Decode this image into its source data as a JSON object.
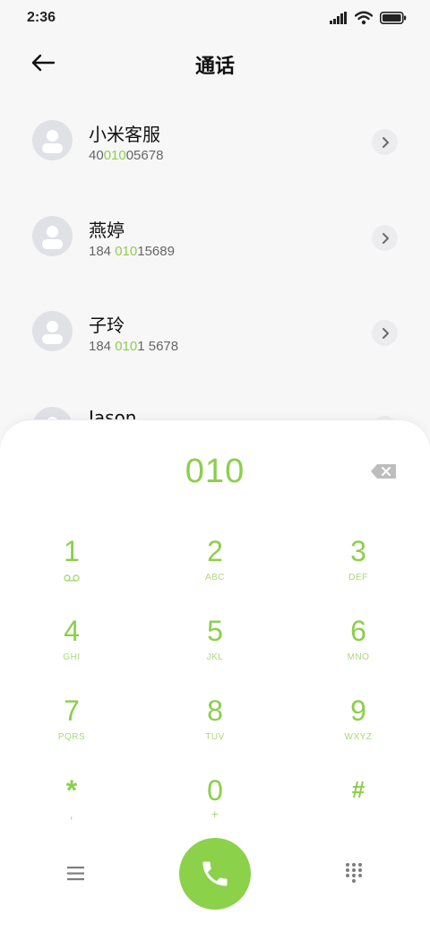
{
  "status_bar": {
    "time": "2:36"
  },
  "header": {
    "title": "通话"
  },
  "contacts": [
    {
      "name": "小米客服",
      "number_pre": "40",
      "number_match": "010",
      "number_post": "05678"
    },
    {
      "name": "燕婷",
      "number_pre": "184 ",
      "number_match": "010",
      "number_post": "15689"
    },
    {
      "name": "子玲",
      "number_pre": "184 ",
      "number_match": "010",
      "number_post": "1 5678"
    },
    {
      "name": "Jason",
      "number_pre": "",
      "number_match": "",
      "number_post": ""
    }
  ],
  "dialpad": {
    "input": "010",
    "keys": [
      {
        "digit": "1",
        "letters": ""
      },
      {
        "digit": "2",
        "letters": "ABC"
      },
      {
        "digit": "3",
        "letters": "DEF"
      },
      {
        "digit": "4",
        "letters": "GHI"
      },
      {
        "digit": "5",
        "letters": "JKL"
      },
      {
        "digit": "6",
        "letters": "MNO"
      },
      {
        "digit": "7",
        "letters": "PQRS"
      },
      {
        "digit": "8",
        "letters": "TUV"
      },
      {
        "digit": "9",
        "letters": "WXYZ"
      },
      {
        "digit": "*",
        "letters": ","
      },
      {
        "digit": "0",
        "letters": "+"
      },
      {
        "digit": "#",
        "letters": ""
      }
    ]
  },
  "icons": {
    "back": "arrow-left-icon",
    "detail": "chevron-right-icon",
    "backspace": "backspace-icon",
    "voicemail": "voicemail-icon",
    "menu": "menu-icon",
    "call": "phone-icon",
    "keypad": "dialpad-icon"
  },
  "colors": {
    "accent": "#8bcf4a",
    "call_button": "#8bd14a",
    "background": "#f7f7f7"
  }
}
